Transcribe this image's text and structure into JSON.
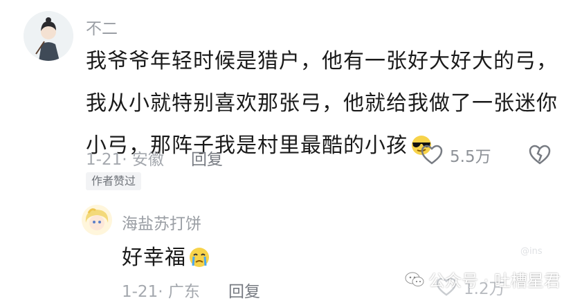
{
  "comment": {
    "username": "不二",
    "text_lines": [
      "我爷爷年轻时候是猎户，他有一张好大好大的弓，",
      "我从小就特别喜欢那张弓，他就给我做了一张迷你",
      "小弓，那阵子我是村里最酷的小孩"
    ],
    "emoji": "sunglasses-face",
    "date": "1-21",
    "location": "安徽",
    "reply_label": "回复",
    "like_count": "5.5万",
    "badge": "作者赞过"
  },
  "reply": {
    "username": "海盐苏打饼",
    "text": "好幸福",
    "emoji": "crying-face",
    "date": "1-21",
    "location": "广东",
    "reply_label": "回复",
    "like_count": "1.2万"
  },
  "watermark": {
    "text": "公众号 · 吐槽星君",
    "faint_text": "@ins"
  },
  "colors": {
    "primary_text": "#1a1a1a",
    "secondary_text": "#9a9ea4",
    "meta_text": "#a4a8ae",
    "icon": "#777b82",
    "badge_bg": "#f2f3f5"
  }
}
